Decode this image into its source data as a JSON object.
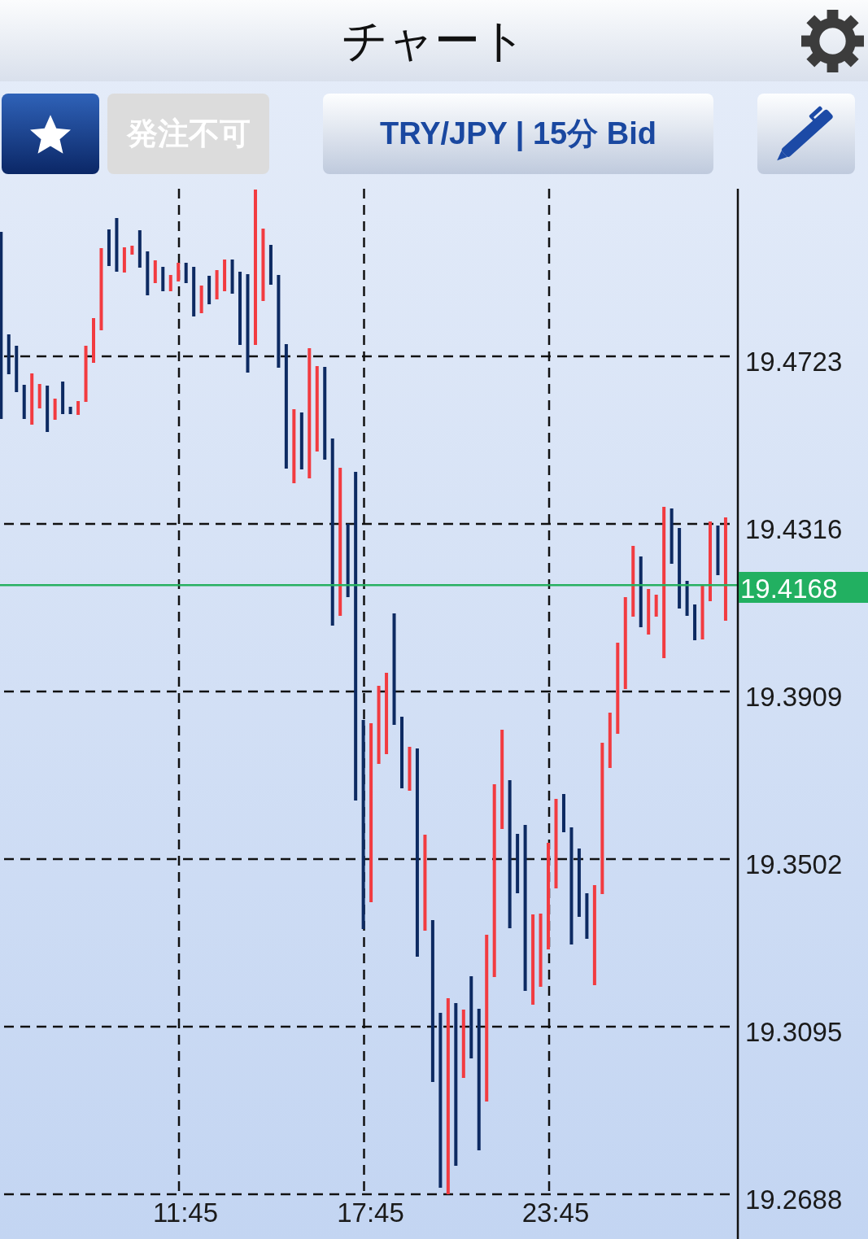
{
  "header": {
    "title": "チャート"
  },
  "toolbar": {
    "order_button": {
      "label": "発注不可",
      "disabled": true
    },
    "symbol_button": {
      "label": "TRY/JPY | 15分 Bid"
    }
  },
  "chart": {
    "y_axis_labels": [
      "19.4723",
      "19.4316",
      "19.3909",
      "19.3502",
      "19.3095",
      "19.2688"
    ],
    "x_axis_labels": [
      "11:45",
      "17:45",
      "23:45"
    ],
    "current_price": "19.4168"
  }
}
